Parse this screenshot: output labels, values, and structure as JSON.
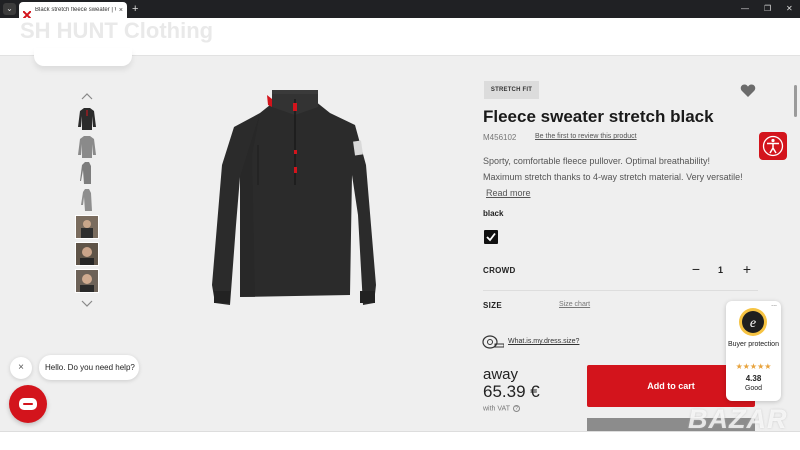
{
  "browser": {
    "tab_title": "Black stretch fleece sweater | Wo...",
    "tab_close": "×",
    "new_tab": "+",
    "minimize": "—",
    "maximize": "❐",
    "close": "✕",
    "menu": "⌄"
  },
  "header": {
    "brand": "SH HUNT Clothing"
  },
  "product": {
    "badge": "STRETCH FIT",
    "title": "Fleece sweater stretch black",
    "sku": "M456102",
    "review_link": "Be the first to review this product",
    "description_line1": "Sporty, comfortable fleece pullover. Optimal breathability!",
    "description_line2": "Maximum stretch thanks to 4-way stretch material. Very versatile!",
    "read_more": "Read more",
    "color_name": "black",
    "quantity_label": "CROWD",
    "quantity_minus": "−",
    "quantity_value": "1",
    "quantity_plus": "+",
    "size_label": "SIZE",
    "size_chart": "Size chart",
    "dress_size_link": "What.is.my.dress.size?",
    "price_prefix": "away",
    "price": "65.39 €",
    "vat_note": "with VAT",
    "vat_info": "?",
    "add_to_cart": "Add to cart"
  },
  "trust_badge": {
    "menu": "...",
    "label": "Buyer protection",
    "stars": "★★★★★",
    "score": "4.38",
    "grade": "Good"
  },
  "chat": {
    "close": "×",
    "message": "Hello. Do you need help?"
  },
  "watermark": "BAZAR",
  "colors": {
    "accent_red": "#d3141c",
    "page_bg": "#efefef",
    "garment": "#2b2b2b"
  },
  "icons": [
    "chevron-up-icon",
    "chevron-down-icon",
    "heart-icon",
    "accessibility-icon",
    "measuring-tape-icon",
    "info-icon",
    "chat-icon",
    "close-icon",
    "checkmark-icon",
    "shield-seal-icon"
  ]
}
